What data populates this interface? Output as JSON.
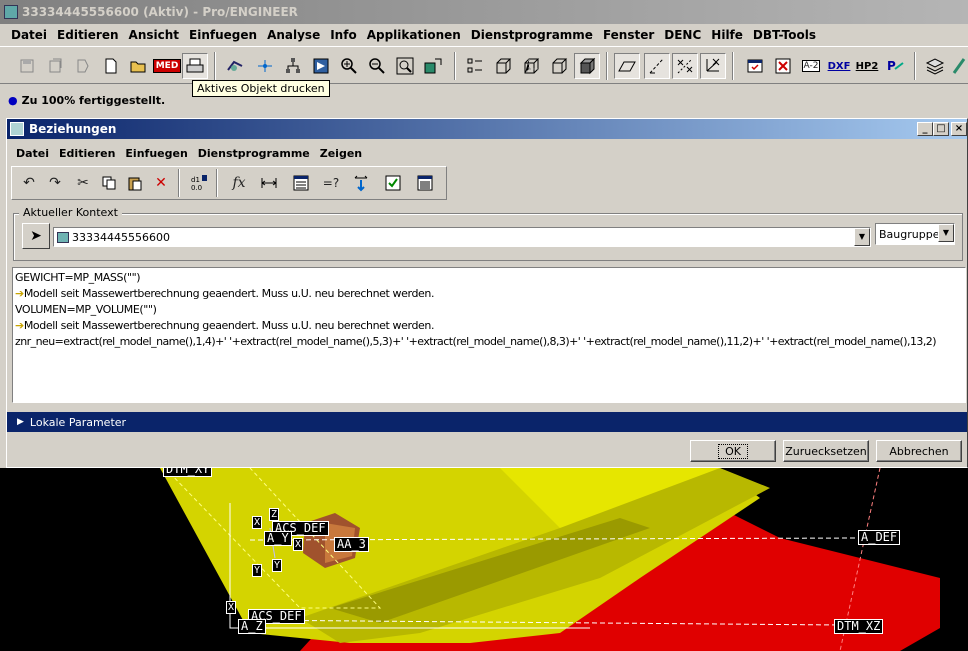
{
  "window": {
    "title": "33334445556600 (Aktiv) - Pro/ENGINEER"
  },
  "main_menu": [
    "Datei",
    "Editieren",
    "Ansicht",
    "Einfuegen",
    "Analyse",
    "Info",
    "Applikationen",
    "Dienstprogramme",
    "Fenster",
    "DENC",
    "Hilfe",
    "DBT-Tools"
  ],
  "toolbar_labels": {
    "med": "MED",
    "dxf": "DXF",
    "hp2": "HP2",
    "a2": "A-2"
  },
  "tooltip": "Aktives Objekt drucken",
  "status": "Zu 100% fertiggestellt.",
  "dialog": {
    "title": "Beziehungen",
    "menu": [
      "Datei",
      "Editieren",
      "Einfuegen",
      "Dienstprogramme",
      "Zeigen"
    ],
    "context_label": "Aktueller Kontext",
    "context_value": "33334445556600",
    "context_type": "Baugruppe",
    "relations": [
      {
        "text": "GEWICHT=MP_MASS(\"\")",
        "warn": false
      },
      {
        "text": "Modell seit Massewertberechnung geaendert. Muss u.U. neu berechnet werden.",
        "warn": true
      },
      {
        "text": "VOLUMEN=MP_VOLUME(\"\")",
        "warn": false
      },
      {
        "text": "Modell seit Massewertberechnung geaendert. Muss u.U. neu berechnet werden.",
        "warn": true
      },
      {
        "text": "znr_neu=extract(rel_model_name(),1,4)+' '+extract(rel_model_name(),5,3)+' '+extract(rel_model_name(),8,3)+' '+extract(rel_model_name(),11,2)+' '+extract(rel_model_name(),13,2)",
        "warn": false
      }
    ],
    "local_params": "Lokale Parameter",
    "buttons": {
      "ok": "OK",
      "reset": "Zuruecksetzen",
      "cancel": "Abbrechen"
    }
  },
  "viewport": {
    "datums": {
      "a_def": "A_DEF",
      "dtm_xz": "DTM_XZ",
      "acs_def": "ACS_DEF",
      "acs_def_2": "ACS_DEF",
      "a_y": "A_Y",
      "a_z": "A_Z",
      "aa": "AA_3",
      "dtm_top": "DTM_XY"
    },
    "axes": {
      "z": "Z",
      "x1": "X",
      "x2": "X",
      "y1": "Y",
      "y2": "Y",
      "x3": "X"
    },
    "colors": {
      "background": "#000000",
      "yellow_part": "#d4d400",
      "red_part": "#e00000",
      "brown_part": "#a0522d"
    }
  }
}
